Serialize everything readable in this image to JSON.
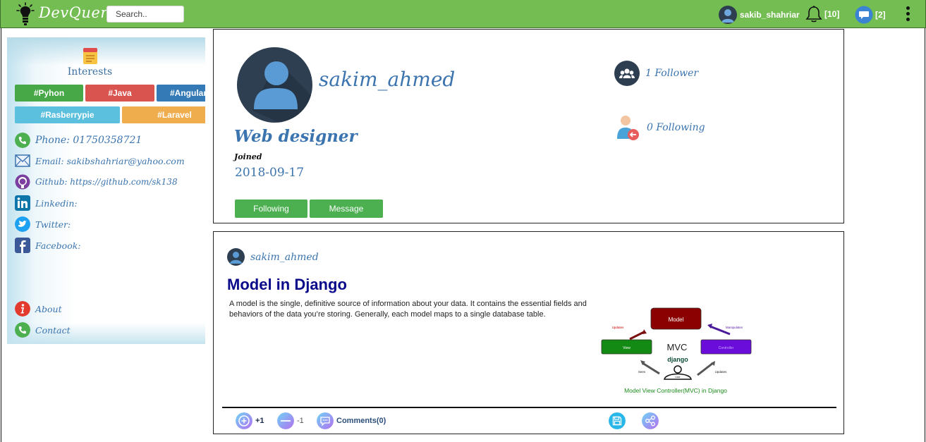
{
  "navbar": {
    "brand": "DevQuery",
    "search_placeholder": "Search..",
    "user_name": "sakib_shahriar",
    "notifications_count": "[10]",
    "messages_count": "[2]"
  },
  "sidebar": {
    "interests_title": "Interests",
    "tags": [
      {
        "label": "#Pyhon",
        "color": "#46a846"
      },
      {
        "label": "#Java",
        "color": "#d9534f"
      },
      {
        "label": "#Angular JS",
        "color": "#337ab7"
      },
      {
        "label": "#Rasberrypie",
        "color": "#5bc0de"
      },
      {
        "label": "#Laravel",
        "color": "#f0ad4e"
      }
    ],
    "contacts": [
      {
        "label": "Phone: 01750358721",
        "icon": "phone-icon"
      },
      {
        "label": "Email: sakibshahriar@yahoo.com",
        "icon": "email-icon"
      },
      {
        "label": "Github: https://github.com/sk138",
        "icon": "github-icon"
      },
      {
        "label": "Linkedin:",
        "icon": "linkedin-icon"
      },
      {
        "label": "Twitter:",
        "icon": "twitter-icon"
      },
      {
        "label": "Facebook:",
        "icon": "facebook-icon"
      }
    ],
    "footer_links": [
      {
        "label": "About",
        "icon": "info-icon"
      },
      {
        "label": "Contact",
        "icon": "phone-icon"
      }
    ]
  },
  "profile": {
    "username": "sakim_ahmed",
    "title": "Web designer",
    "joined_label": "Joined",
    "joined_date": "2018-09-17",
    "following_button": "Following",
    "message_button": "Message",
    "followers": "1 Follower",
    "following": "0 Following"
  },
  "post": {
    "author": "sakim_ahmed",
    "title": "Model in Django",
    "body": "A model is the single, definitive source of information about your data. It contains the essential fields and behaviors of the data you’re storing. Generally, each model maps to a single database table.",
    "diagram": {
      "model": "Model",
      "view": "View",
      "controller": "Controller",
      "center": "MVC",
      "brand": "django",
      "user": "User",
      "updates_left": "Updates",
      "manipulates": "Manipulates",
      "sees": "Sees",
      "updates_right": "Updates",
      "caption": "Model View Controller(MVC) in Django"
    },
    "upvote_label": "+1",
    "downvote_label": "-1",
    "comments_label": "Comments(0)"
  },
  "colors": {
    "navbar": "#74bd52",
    "accent_blue": "#3b74ae",
    "button_green": "#4caf50"
  }
}
